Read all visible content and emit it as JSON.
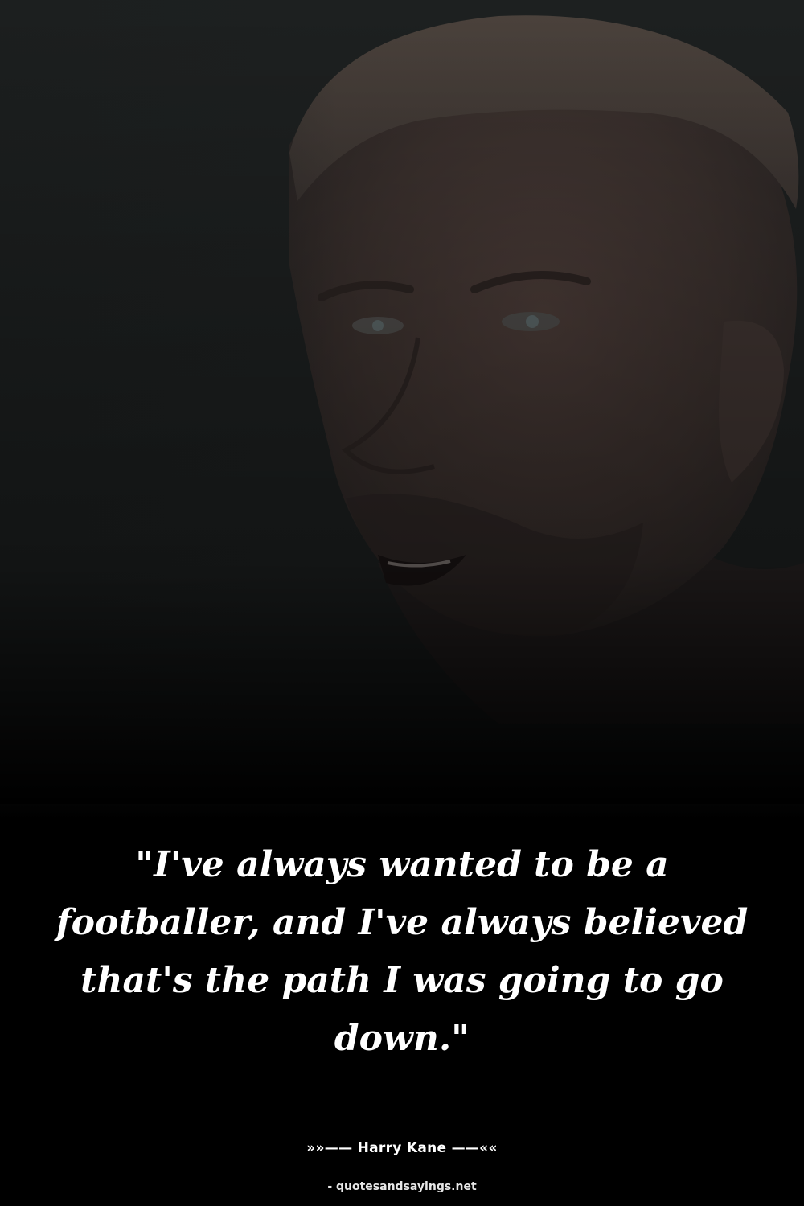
{
  "quote": {
    "text": "\"I've always wanted to be a footballer, and I've always believed that's the path I was going to go down.\""
  },
  "author": {
    "name": "»»—— Harry Kane ——««"
  },
  "source": {
    "label": "- quotesandsayings.net"
  },
  "colors": {
    "background": "#000000",
    "photo_tone": "#1c1f1f",
    "text": "#ffffff"
  },
  "icons": {
    "photo": "portrait-photo"
  }
}
